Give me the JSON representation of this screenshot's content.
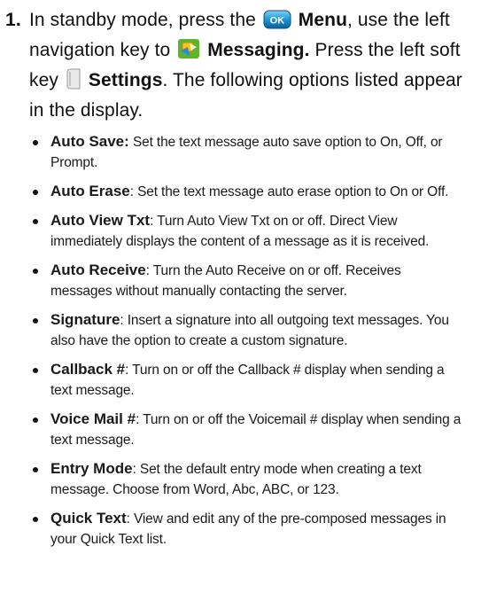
{
  "step": {
    "number": "1.",
    "seg1": "In standby mode, press the ",
    "menu_label": "Menu",
    "seg2": ", use the left navigation key to ",
    "messaging_label": "Messaging.",
    "seg3": " Press the left soft key ",
    "settings_label": "Settings",
    "seg4": ". The following options listed appear in the display.",
    "icons": {
      "ok": "ok-key-icon",
      "messaging": "messaging-icon",
      "settings": "settings-icon"
    },
    "icon_text": {
      "ok": "OK"
    }
  },
  "options": [
    {
      "term": "Auto Save:",
      "desc": " Set the text message auto save option to On, Off, or Prompt."
    },
    {
      "term": "Auto Erase",
      "desc": ": Set the text message auto erase option to On or Off."
    },
    {
      "term": "Auto View Txt",
      "desc": ": Turn Auto View Txt on or off. Direct View immediately displays the content of a message as it is received."
    },
    {
      "term": "Auto Receive",
      "desc": ": Turn the Auto Receive on or off. Receives messages without manually contacting the server."
    },
    {
      "term": "Signature",
      "desc": ": Insert a signature into all outgoing text messages. You also have the option to create a custom signature."
    },
    {
      "term": "Callback #",
      "desc": ": Turn on or off the Callback # display when sending a text message."
    },
    {
      "term": "Voice Mail #",
      "desc": ": Turn on or off the Voicemail # display when sending a text message."
    },
    {
      "term": "Entry Mode",
      "desc": ": Set the default entry mode when creating a text message. Choose from Word, Abc, ABC, or 123."
    },
    {
      "term": "Quick Text",
      "desc": ": View and edit any of the pre-composed messages in your Quick Text list."
    }
  ]
}
